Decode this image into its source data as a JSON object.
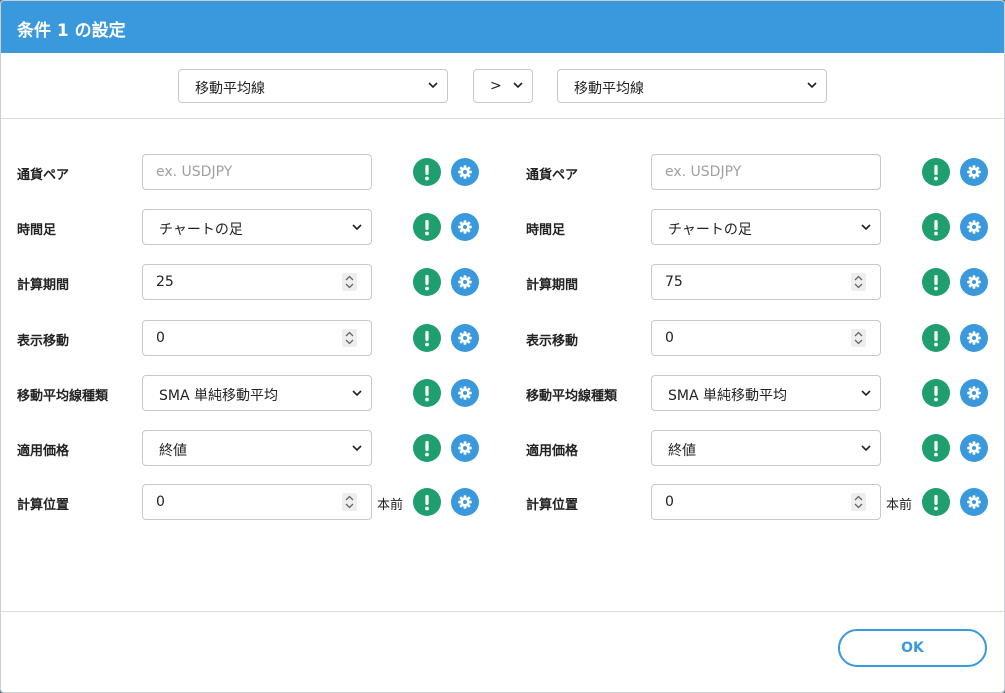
{
  "dialog": {
    "title": "条件 1 の設定"
  },
  "comparison": {
    "left_indicator": "移動平均線",
    "operator": ">",
    "right_indicator": "移動平均線"
  },
  "left_panel": {
    "currency_pair": {
      "label": "通貨ペア",
      "placeholder": "ex. USDJPY",
      "value": ""
    },
    "timeframe": {
      "label": "時間足",
      "value": "チャートの足"
    },
    "period": {
      "label": "計算期間",
      "value": "25"
    },
    "shift": {
      "label": "表示移動",
      "value": "0"
    },
    "ma_type": {
      "label": "移動平均線種類",
      "value": "SMA 単純移動平均"
    },
    "applied_price": {
      "label": "適用価格",
      "value": "終値"
    },
    "calc_position": {
      "label": "計算位置",
      "value": "0",
      "unit": "本前"
    }
  },
  "right_panel": {
    "currency_pair": {
      "label": "通貨ペア",
      "placeholder": "ex. USDJPY",
      "value": ""
    },
    "timeframe": {
      "label": "時間足",
      "value": "チャートの足"
    },
    "period": {
      "label": "計算期間",
      "value": "75"
    },
    "shift": {
      "label": "表示移動",
      "value": "0"
    },
    "ma_type": {
      "label": "移動平均線種類",
      "value": "SMA 単純移動平均"
    },
    "applied_price": {
      "label": "適用価格",
      "value": "終値"
    },
    "calc_position": {
      "label": "計算位置",
      "value": "0",
      "unit": "本前"
    }
  },
  "footer": {
    "ok_label": "OK"
  },
  "colors": {
    "header": "#3a99dc",
    "info_button": "#1f9e6f",
    "settings_button": "#3a99dc"
  },
  "icons": {
    "info": "exclamation-icon",
    "settings": "gear-icon",
    "dropdown": "chevron-down-icon",
    "spinner": "spinner-arrows-icon"
  }
}
